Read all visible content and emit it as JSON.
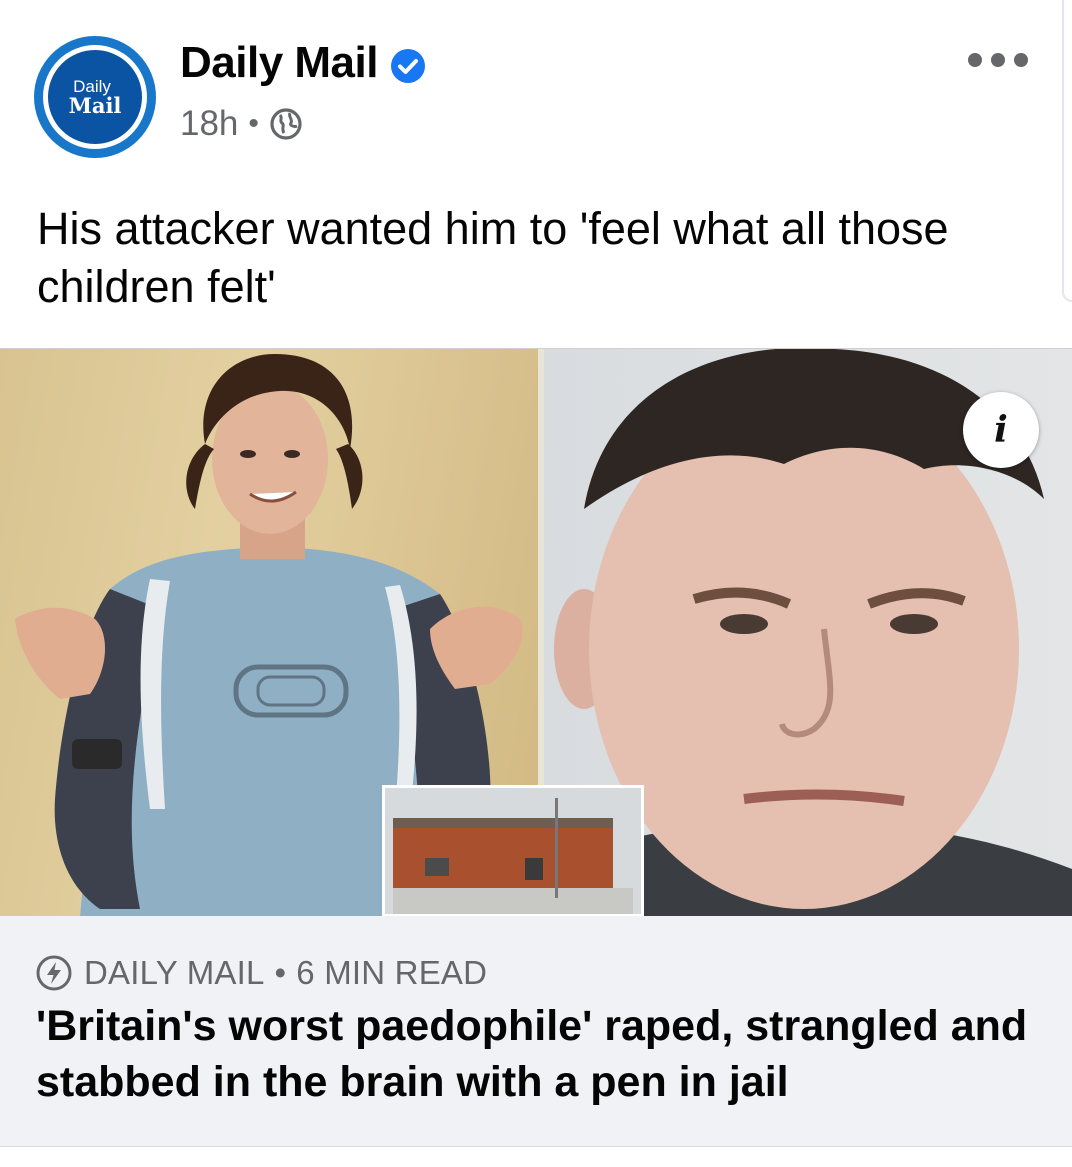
{
  "post": {
    "page_name": "Daily Mail",
    "avatar": {
      "line1": "Daily",
      "line2": "Mail"
    },
    "timestamp": "18h",
    "separator": "•",
    "caption": "His attacker wanted him to 'feel what all those children felt'"
  },
  "icons": {
    "verified": "verified-badge-icon",
    "privacy": "globe-icon",
    "more": "more-options-icon",
    "info": "info-icon",
    "instant_article": "lightning-bolt-icon"
  },
  "media": {
    "info_label": "i"
  },
  "link_preview": {
    "source": "DAILY MAIL",
    "separator": "•",
    "read_time": "6 MIN READ",
    "headline": "'Britain's worst paedophile' raped, strangled and stabbed in the brain with a pen in jail"
  },
  "colors": {
    "brand_blue": "#1877c9",
    "verified_blue": "#1877f2",
    "secondary_text": "#65676b",
    "preview_bg": "#f0f2f5"
  }
}
